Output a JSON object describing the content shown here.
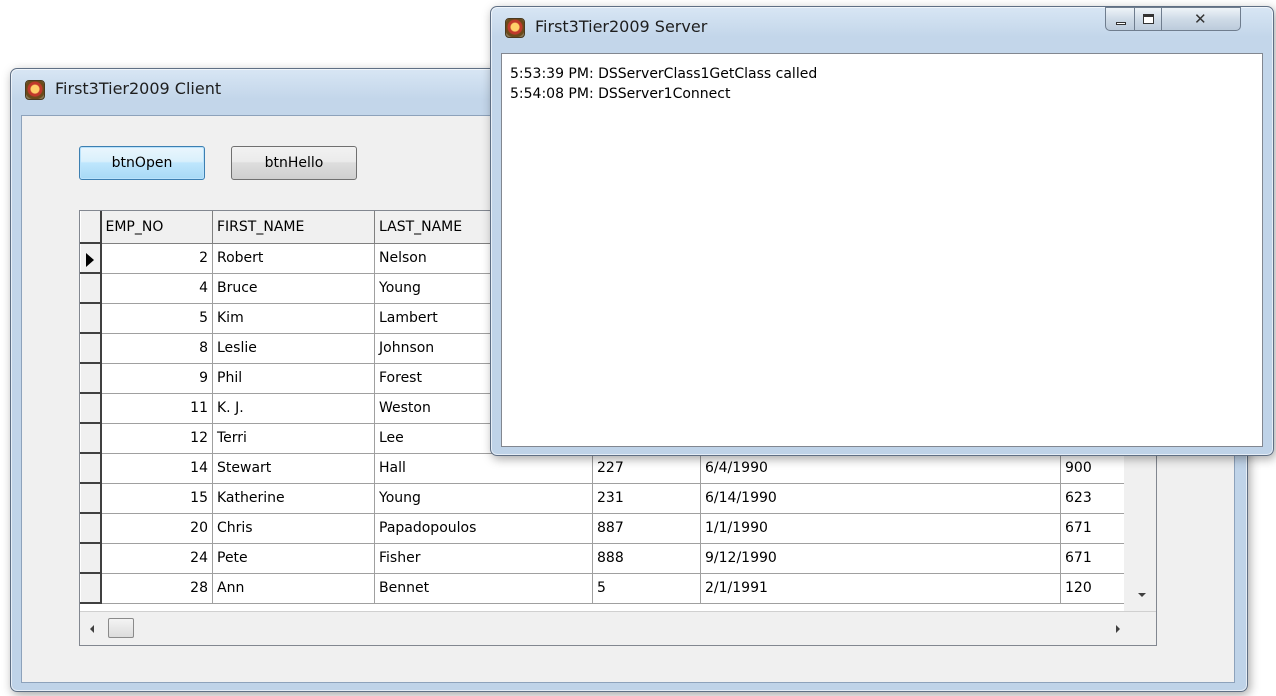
{
  "client_window": {
    "title": "First3Tier2009 Client",
    "icon": "app-icon",
    "buttons": {
      "open_label": "btnOpen",
      "hello_label": "btnHello"
    },
    "grid": {
      "columns": [
        "EMP_NO",
        "FIRST_NAME",
        "LAST_NAME",
        "",
        "",
        ""
      ],
      "rows": [
        [
          "2",
          "Robert",
          "Nelson",
          "",
          "",
          ""
        ],
        [
          "4",
          "Bruce",
          "Young",
          "",
          "",
          ""
        ],
        [
          "5",
          "Kim",
          "Lambert",
          "",
          "",
          ""
        ],
        [
          "8",
          "Leslie",
          "Johnson",
          "",
          "",
          ""
        ],
        [
          "9",
          "Phil",
          "Forest",
          "",
          "",
          ""
        ],
        [
          "11",
          "K. J.",
          "Weston",
          "",
          "",
          ""
        ],
        [
          "12",
          "Terri",
          "Lee",
          "",
          "",
          ""
        ],
        [
          "14",
          "Stewart",
          "Hall",
          "227",
          "6/4/1990",
          "900"
        ],
        [
          "15",
          "Katherine",
          "Young",
          "231",
          "6/14/1990",
          "623"
        ],
        [
          "20",
          "Chris",
          "Papadopoulos",
          "887",
          "1/1/1990",
          "671"
        ],
        [
          "24",
          "Pete",
          "Fisher",
          "888",
          "9/12/1990",
          "671"
        ],
        [
          "28",
          "Ann",
          "Bennet",
          "5",
          "2/1/1991",
          "120"
        ]
      ],
      "selected_row": 0
    }
  },
  "server_window": {
    "title": "First3Tier2009 Server",
    "icon": "app-icon",
    "log_lines": [
      "5:53:39 PM: DSServerClass1GetClass called",
      "5:54:08 PM: DSServer1Connect"
    ]
  },
  "colors": {
    "frame": "#c3d6ea",
    "face": "#f0f0f0",
    "focus_button": "#bee6fd"
  }
}
